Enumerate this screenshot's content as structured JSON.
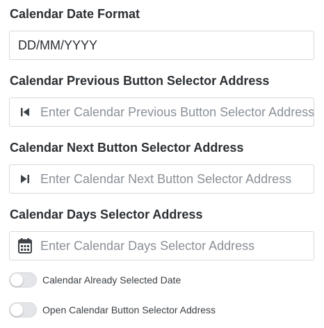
{
  "fields": {
    "date_format": {
      "label": "Calendar Date Format",
      "value": "DD/MM/YYYY",
      "placeholder": ""
    },
    "previous_button": {
      "label": "Calendar Previous Button Selector Address",
      "value": "",
      "placeholder": "Enter Calendar Previous Button Selector Address",
      "icon": "skip-previous-icon"
    },
    "next_button": {
      "label": "Calendar Next Button Selector Address",
      "value": "",
      "placeholder": "Enter Calendar Next Button Selector Address",
      "icon": "skip-next-icon"
    },
    "days_selector": {
      "label": "Calendar Days Selector Address",
      "value": "",
      "placeholder": "Enter Calendar Days Selector Address",
      "icon": "calendar-icon"
    }
  },
  "toggles": {
    "already_selected_date": {
      "label": "Calendar Already Selected Date",
      "on": false
    },
    "open_calendar_button": {
      "label": "Open Calendar Button Selector Address",
      "on": false
    }
  },
  "colors": {
    "icon": "#3d4247",
    "toggle_off": "#e3e5e8",
    "border": "#d4d8dc"
  }
}
